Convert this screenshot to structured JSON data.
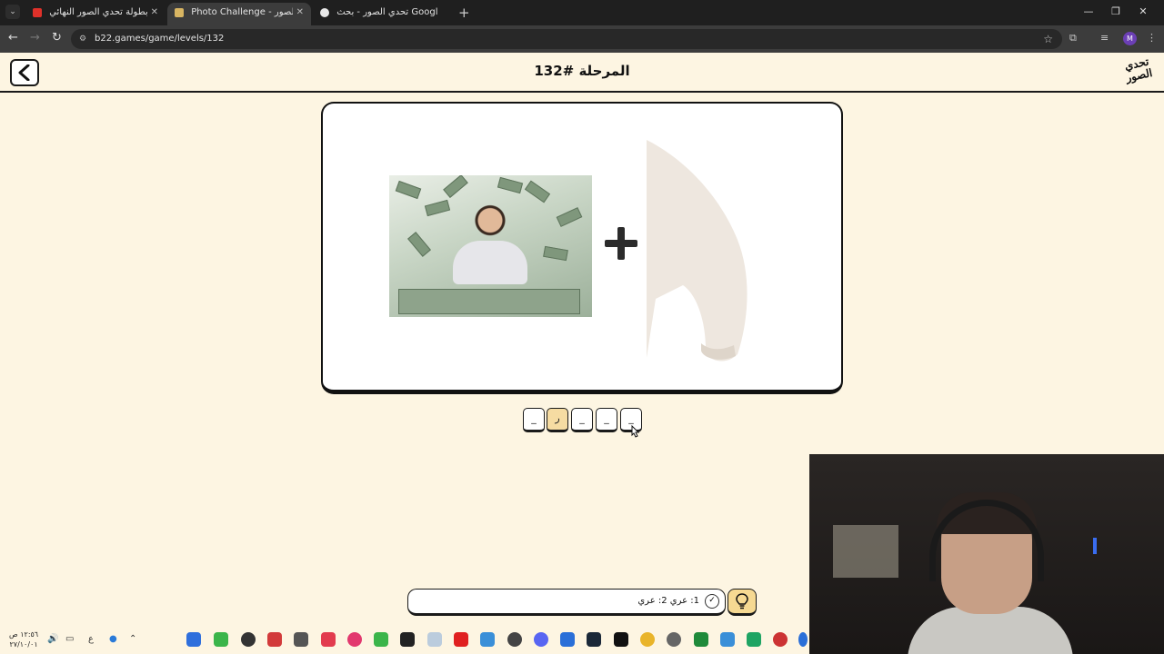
{
  "browser": {
    "tabs": [
      {
        "title": "بطولة تحدي الصور النهائي ⭐ 🌙",
        "active": false,
        "favicon_color": "#e0312a"
      },
      {
        "title": "Photo Challenge - تحدي الصور",
        "active": true,
        "favicon_color": "#d8b562"
      },
      {
        "title": "تحدي الصور - بحث Google",
        "active": false,
        "favicon_color": "#e8e8e8"
      }
    ],
    "url": "b22.games/game/levels/132",
    "profile_initial": "M"
  },
  "header": {
    "title": "المرحلة #132",
    "logo_text": "تحدي الصور",
    "back_icon": "chevron-left-icon"
  },
  "puzzle": {
    "image_1": "man-with-money-rain",
    "operator": "plus-icon",
    "image_2": "sweater-sleeve"
  },
  "slots": [
    {
      "letter": "_",
      "filled": false
    },
    {
      "letter": "ر",
      "filled": true
    },
    {
      "letter": "_",
      "filled": false
    },
    {
      "letter": "_",
      "filled": false
    },
    {
      "letter": "_",
      "filled": false
    }
  ],
  "answer_bar": {
    "text": "1: عري 2: عري",
    "icon": "check-circle-icon"
  },
  "hint_button": {
    "icon": "lightbulb-icon"
  },
  "taskbar": {
    "time": "١٢:٥٦ ص",
    "date": "٢٧/١٠/٠١",
    "lang": "ع"
  },
  "colors": {
    "page_bg": "#fdf5e2",
    "filled_slot": "#f6dca2",
    "hint_button": "#f6d992"
  }
}
